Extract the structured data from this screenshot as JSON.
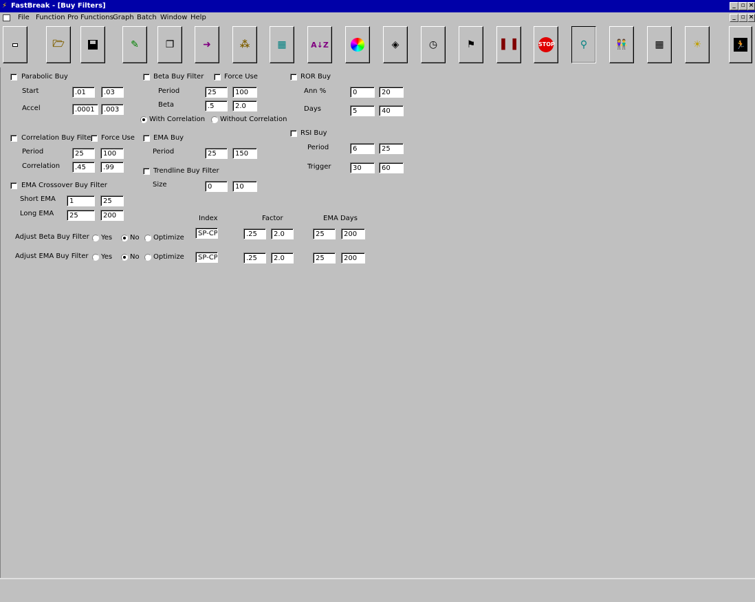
{
  "window": {
    "title": "FastBreak - [Buy Filters]"
  },
  "menu": [
    "File",
    "Function",
    "Pro Functions",
    "Graph",
    "Batch",
    "Window",
    "Help"
  ],
  "toolbar": [
    "minimize-icon",
    "open-folder-icon",
    "save-icon",
    "edit-icon",
    "copy-icon",
    "export-icon",
    "tree-icon",
    "book-icon",
    "sort-az-icon",
    "color-wheel-icon",
    "eraser-icon",
    "stopwatch-icon",
    "checkered-flag-icon",
    "bar-chart-icon",
    "stop-icon",
    "faucet-icon",
    "people-icon",
    "table-icon",
    "lightbulb-icon",
    "exit-icon"
  ],
  "parabolic": {
    "label": "Parabolic Buy",
    "start_label": "Start",
    "start_min": ".01",
    "start_max": ".03",
    "accel_label": "Accel",
    "accel_min": ".0001",
    "accel_max": ".003"
  },
  "beta": {
    "label": "Beta Buy Filter",
    "force_label": "Force Use",
    "period_label": "Period",
    "period_min": "25",
    "period_max": "100",
    "beta_label": "Beta",
    "beta_min": ".5",
    "beta_max": "2.0",
    "with_corr": "With Correlation",
    "without_corr": "Without Correlation"
  },
  "ror": {
    "label": "ROR Buy",
    "ann_label": "Ann %",
    "ann_min": "0",
    "ann_max": "20",
    "days_label": "Days",
    "days_min": "5",
    "days_max": "40"
  },
  "correlation": {
    "label": "Correlation Buy Filter",
    "force_label": "Force Use",
    "period_label": "Period",
    "period_min": "25",
    "period_max": "100",
    "corr_label": "Correlation",
    "corr_min": ".45",
    "corr_max": ".99"
  },
  "ema": {
    "label": "EMA Buy",
    "period_label": "Period",
    "period_min": "25",
    "period_max": "150"
  },
  "rsi": {
    "label": "RSI Buy",
    "period_label": "Period",
    "period_min": "6",
    "period_max": "25",
    "trigger_label": "Trigger",
    "trigger_min": "30",
    "trigger_max": "60"
  },
  "trendline": {
    "label": "Trendline Buy Filter",
    "size_label": "Size",
    "size_min": "0",
    "size_max": "10"
  },
  "ema_cross": {
    "label": "EMA Crossover Buy Filter",
    "short_label": "Short EMA",
    "short_min": "1",
    "short_max": "25",
    "long_label": "Long EMA",
    "long_min": "25",
    "long_max": "200"
  },
  "adjust": {
    "index_header": "Index",
    "factor_header": "Factor",
    "ema_days_header": "EMA Days",
    "yes_label": "Yes",
    "no_label": "No",
    "optimize_label": "Optimize",
    "beta": {
      "label": "Adjust Beta Buy Filter",
      "index": "SP-CP",
      "factor_min": ".25",
      "factor_max": "2.0",
      "days_min": "25",
      "days_max": "200"
    },
    "ema": {
      "label": "Adjust EMA Buy Filter",
      "index": "SP-CP",
      "factor_min": ".25",
      "factor_max": "2.0",
      "days_min": "25",
      "days_max": "200"
    }
  }
}
